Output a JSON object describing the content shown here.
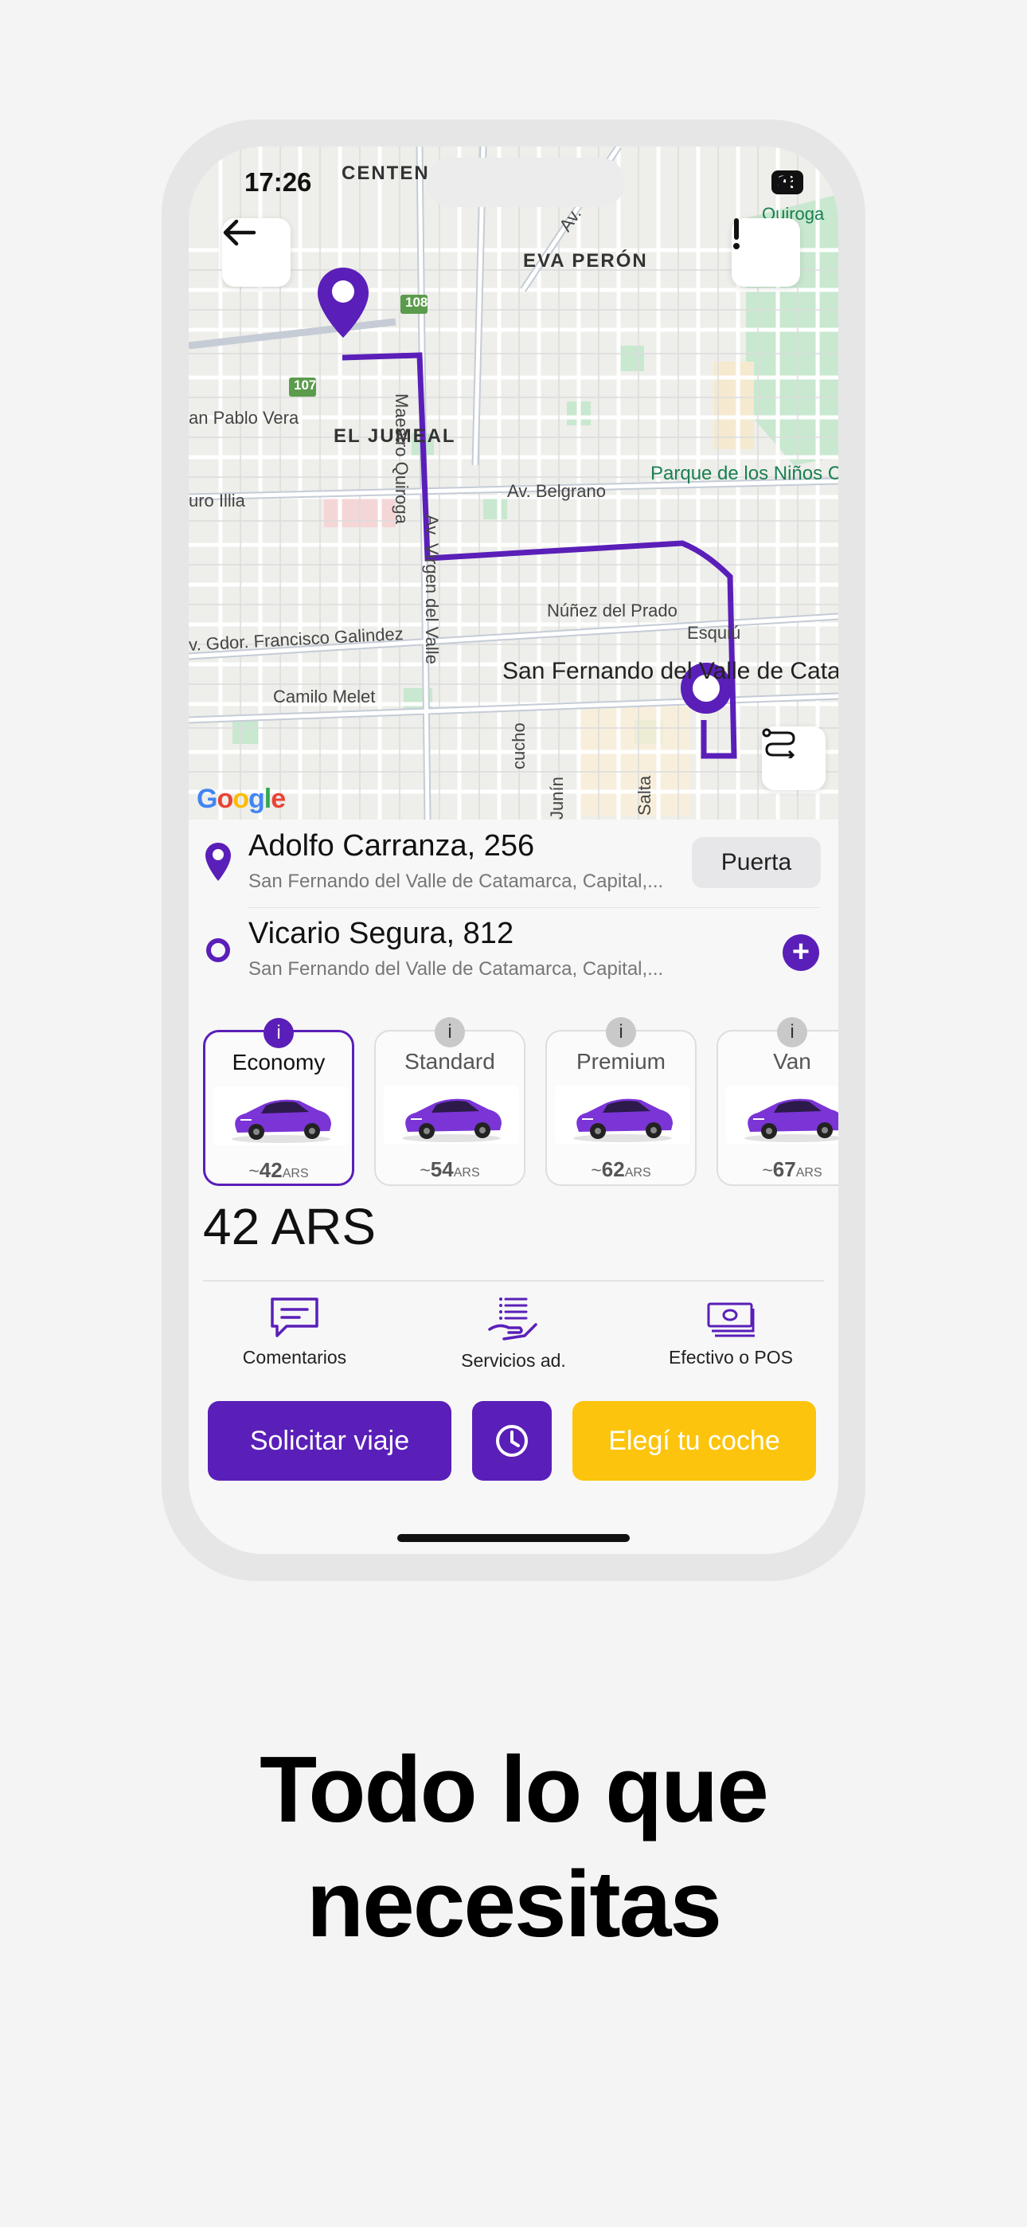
{
  "status_bar": {
    "time": "17:26",
    "battery": "96"
  },
  "map": {
    "labels": {
      "centen": "CENTEN",
      "eva_peron": "EVA PERÓN",
      "av_c": "Av. C",
      "quiroga": "Quiroga",
      "san_pablo_vera": "an Pablo Vera",
      "el_jumeal": "EL JUMEAL",
      "maestro_quiroga": "Maestro Quiroga",
      "parque": "Parque de los Niños Catamarca",
      "av_belgrano": "Av. Belgrano",
      "uro_illia": "uro Illia",
      "av_virgen": "Av. Virgen del Valle",
      "nunez": "Núñez del Prado",
      "galindez": "v. Gdor. Francisco Galindez",
      "esquiu": "Esquiú",
      "city": "San Fernando del Valle de Catamarca",
      "camilo_melet": "Camilo Melet",
      "cucho": "cucho",
      "junin": "Junín",
      "salta": "Salta",
      "route_108": "108",
      "route_107": "107"
    },
    "google_logo": "Google"
  },
  "trip": {
    "origin": {
      "title": "Adolfo Carranza, 256",
      "subtitle": "San Fernando del Valle de Catamarca, Capital,..."
    },
    "door_button": "Puerta",
    "destination": {
      "title": "Vicario Segura, 812",
      "subtitle": "San Fernando del Valle de Catamarca, Capital,..."
    }
  },
  "vehicle_classes": [
    {
      "name": "Economy",
      "price_prefix": "~",
      "price": "42",
      "currency": "ARS",
      "selected": true
    },
    {
      "name": "Standard",
      "price_prefix": "~",
      "price": "54",
      "currency": "ARS",
      "selected": false
    },
    {
      "name": "Premium",
      "price_prefix": "~",
      "price": "62",
      "currency": "ARS",
      "selected": false
    },
    {
      "name": "Van",
      "price_prefix": "~",
      "price": "67",
      "currency": "ARS",
      "selected": false
    }
  ],
  "info_symbol": "i",
  "fare": "42 ARS",
  "options": {
    "comments": "Comentarios",
    "extra_services": "Servicios ad.",
    "payment": "Efectivo o POS"
  },
  "actions": {
    "request": "Solicitar viaje",
    "choose_car": "Elegí tu coche"
  },
  "headline": {
    "line1": "Todo lo que",
    "line2": "necesitas"
  },
  "colors": {
    "brand_purple": "#5a1fb8",
    "accent_yellow": "#fcc40c",
    "park_green": "#1a7f51"
  }
}
